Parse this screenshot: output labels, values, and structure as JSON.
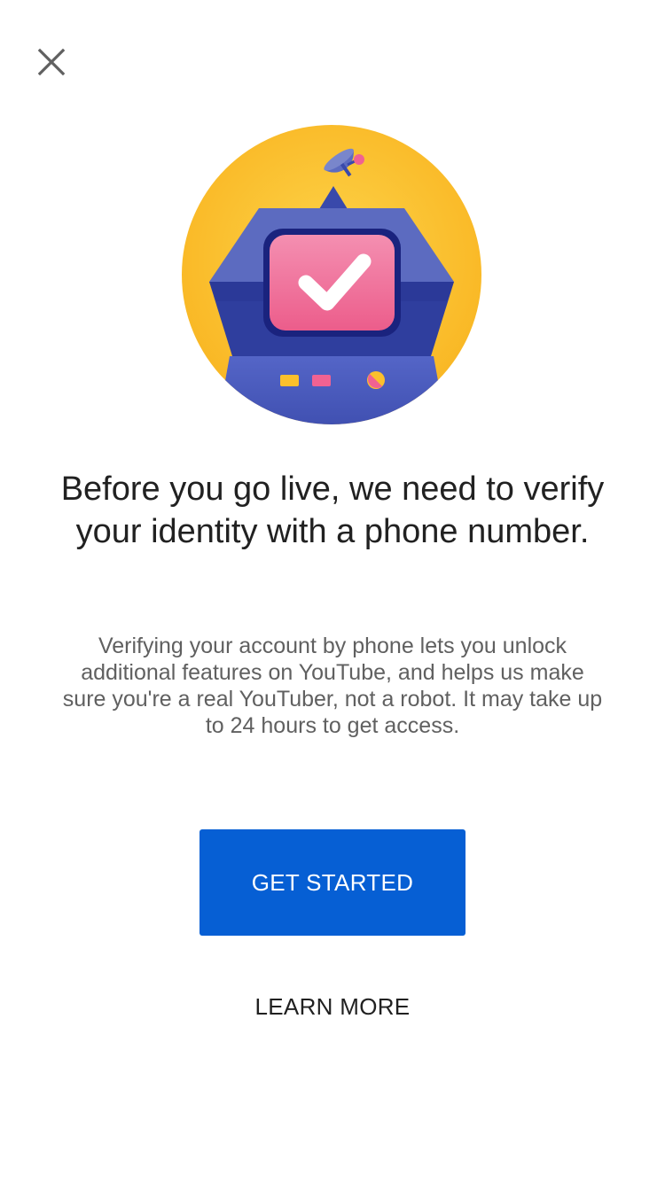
{
  "header": {
    "close_icon": "close-icon"
  },
  "illustration": {
    "icon": "verified-robot-illustration",
    "colors": {
      "circle": "#FBBC2C",
      "body": "#5C6BC0",
      "screen": "#F06292",
      "check": "#FFFFFF"
    }
  },
  "content": {
    "title": "Before you go live, we need to verify your identity with a phone number.",
    "description": "Verifying your account by phone lets you unlock additional features on YouTube, and helps us make sure you're a real YouTuber, not a robot. It may take up to 24 hours to get access."
  },
  "actions": {
    "primary_label": "GET STARTED",
    "secondary_label": "LEARN MORE"
  },
  "colors": {
    "primary_button": "#065fd4",
    "title_text": "#212121",
    "body_text": "#606060"
  }
}
